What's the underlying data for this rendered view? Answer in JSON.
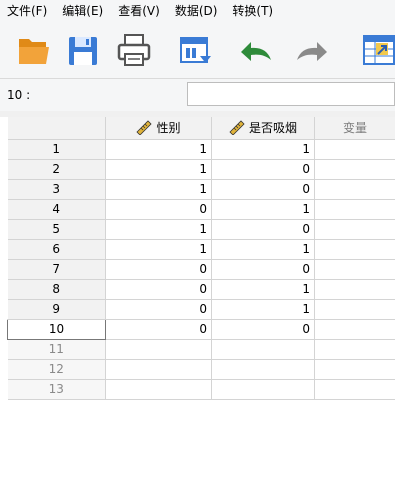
{
  "menu": [
    "文件(F)",
    "编辑(E)",
    "查看(V)",
    "数据(D)",
    "转换(T)"
  ],
  "toolbar": {
    "icons": [
      "open-folder-icon",
      "save-icon",
      "print-icon",
      "dialog-recall-icon",
      "undo-icon",
      "redo-icon",
      "goto-case-icon"
    ]
  },
  "cell_editor": {
    "reference": "10 :",
    "value": ""
  },
  "grid": {
    "columns": [
      {
        "name": "性别",
        "icon": "scale-ruler-icon"
      },
      {
        "name": "是否吸烟",
        "icon": "scale-ruler-icon"
      },
      {
        "name": "变量",
        "icon": ""
      }
    ],
    "rows": [
      {
        "n": "1",
        "cells": [
          "1",
          "1"
        ]
      },
      {
        "n": "2",
        "cells": [
          "1",
          "0"
        ]
      },
      {
        "n": "3",
        "cells": [
          "1",
          "0"
        ]
      },
      {
        "n": "4",
        "cells": [
          "0",
          "1"
        ]
      },
      {
        "n": "5",
        "cells": [
          "1",
          "0"
        ]
      },
      {
        "n": "6",
        "cells": [
          "1",
          "1"
        ]
      },
      {
        "n": "7",
        "cells": [
          "0",
          "0"
        ]
      },
      {
        "n": "8",
        "cells": [
          "0",
          "1"
        ]
      },
      {
        "n": "9",
        "cells": [
          "0",
          "1"
        ]
      },
      {
        "n": "10",
        "cells": [
          "0",
          "0"
        ]
      }
    ],
    "empty_rows": [
      "11",
      "12",
      "13"
    ],
    "current_row": "10"
  },
  "colors": {
    "folder": "#f2a33a",
    "save": "#3a7bd5",
    "undo": "#2e8b3a",
    "redo": "#8a8a8a"
  }
}
